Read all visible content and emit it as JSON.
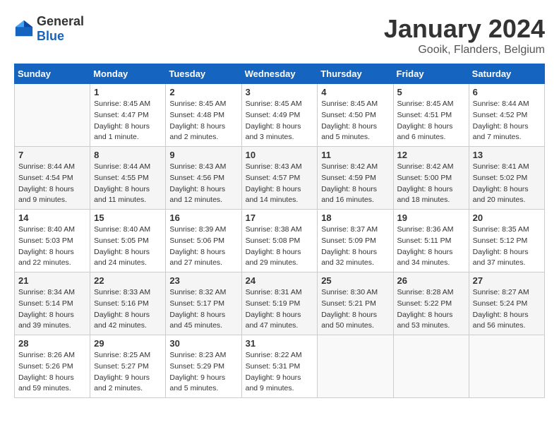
{
  "logo": {
    "text_general": "General",
    "text_blue": "Blue"
  },
  "title": "January 2024",
  "subtitle": "Gooik, Flanders, Belgium",
  "days_of_week": [
    "Sunday",
    "Monday",
    "Tuesday",
    "Wednesday",
    "Thursday",
    "Friday",
    "Saturday"
  ],
  "weeks": [
    [
      {
        "day": "",
        "info": ""
      },
      {
        "day": "1",
        "info": "Sunrise: 8:45 AM\nSunset: 4:47 PM\nDaylight: 8 hours\nand 1 minute."
      },
      {
        "day": "2",
        "info": "Sunrise: 8:45 AM\nSunset: 4:48 PM\nDaylight: 8 hours\nand 2 minutes."
      },
      {
        "day": "3",
        "info": "Sunrise: 8:45 AM\nSunset: 4:49 PM\nDaylight: 8 hours\nand 3 minutes."
      },
      {
        "day": "4",
        "info": "Sunrise: 8:45 AM\nSunset: 4:50 PM\nDaylight: 8 hours\nand 5 minutes."
      },
      {
        "day": "5",
        "info": "Sunrise: 8:45 AM\nSunset: 4:51 PM\nDaylight: 8 hours\nand 6 minutes."
      },
      {
        "day": "6",
        "info": "Sunrise: 8:44 AM\nSunset: 4:52 PM\nDaylight: 8 hours\nand 7 minutes."
      }
    ],
    [
      {
        "day": "7",
        "info": "Sunrise: 8:44 AM\nSunset: 4:54 PM\nDaylight: 8 hours\nand 9 minutes."
      },
      {
        "day": "8",
        "info": "Sunrise: 8:44 AM\nSunset: 4:55 PM\nDaylight: 8 hours\nand 11 minutes."
      },
      {
        "day": "9",
        "info": "Sunrise: 8:43 AM\nSunset: 4:56 PM\nDaylight: 8 hours\nand 12 minutes."
      },
      {
        "day": "10",
        "info": "Sunrise: 8:43 AM\nSunset: 4:57 PM\nDaylight: 8 hours\nand 14 minutes."
      },
      {
        "day": "11",
        "info": "Sunrise: 8:42 AM\nSunset: 4:59 PM\nDaylight: 8 hours\nand 16 minutes."
      },
      {
        "day": "12",
        "info": "Sunrise: 8:42 AM\nSunset: 5:00 PM\nDaylight: 8 hours\nand 18 minutes."
      },
      {
        "day": "13",
        "info": "Sunrise: 8:41 AM\nSunset: 5:02 PM\nDaylight: 8 hours\nand 20 minutes."
      }
    ],
    [
      {
        "day": "14",
        "info": "Sunrise: 8:40 AM\nSunset: 5:03 PM\nDaylight: 8 hours\nand 22 minutes."
      },
      {
        "day": "15",
        "info": "Sunrise: 8:40 AM\nSunset: 5:05 PM\nDaylight: 8 hours\nand 24 minutes."
      },
      {
        "day": "16",
        "info": "Sunrise: 8:39 AM\nSunset: 5:06 PM\nDaylight: 8 hours\nand 27 minutes."
      },
      {
        "day": "17",
        "info": "Sunrise: 8:38 AM\nSunset: 5:08 PM\nDaylight: 8 hours\nand 29 minutes."
      },
      {
        "day": "18",
        "info": "Sunrise: 8:37 AM\nSunset: 5:09 PM\nDaylight: 8 hours\nand 32 minutes."
      },
      {
        "day": "19",
        "info": "Sunrise: 8:36 AM\nSunset: 5:11 PM\nDaylight: 8 hours\nand 34 minutes."
      },
      {
        "day": "20",
        "info": "Sunrise: 8:35 AM\nSunset: 5:12 PM\nDaylight: 8 hours\nand 37 minutes."
      }
    ],
    [
      {
        "day": "21",
        "info": "Sunrise: 8:34 AM\nSunset: 5:14 PM\nDaylight: 8 hours\nand 39 minutes."
      },
      {
        "day": "22",
        "info": "Sunrise: 8:33 AM\nSunset: 5:16 PM\nDaylight: 8 hours\nand 42 minutes."
      },
      {
        "day": "23",
        "info": "Sunrise: 8:32 AM\nSunset: 5:17 PM\nDaylight: 8 hours\nand 45 minutes."
      },
      {
        "day": "24",
        "info": "Sunrise: 8:31 AM\nSunset: 5:19 PM\nDaylight: 8 hours\nand 47 minutes."
      },
      {
        "day": "25",
        "info": "Sunrise: 8:30 AM\nSunset: 5:21 PM\nDaylight: 8 hours\nand 50 minutes."
      },
      {
        "day": "26",
        "info": "Sunrise: 8:28 AM\nSunset: 5:22 PM\nDaylight: 8 hours\nand 53 minutes."
      },
      {
        "day": "27",
        "info": "Sunrise: 8:27 AM\nSunset: 5:24 PM\nDaylight: 8 hours\nand 56 minutes."
      }
    ],
    [
      {
        "day": "28",
        "info": "Sunrise: 8:26 AM\nSunset: 5:26 PM\nDaylight: 8 hours\nand 59 minutes."
      },
      {
        "day": "29",
        "info": "Sunrise: 8:25 AM\nSunset: 5:27 PM\nDaylight: 9 hours\nand 2 minutes."
      },
      {
        "day": "30",
        "info": "Sunrise: 8:23 AM\nSunset: 5:29 PM\nDaylight: 9 hours\nand 5 minutes."
      },
      {
        "day": "31",
        "info": "Sunrise: 8:22 AM\nSunset: 5:31 PM\nDaylight: 9 hours\nand 9 minutes."
      },
      {
        "day": "",
        "info": ""
      },
      {
        "day": "",
        "info": ""
      },
      {
        "day": "",
        "info": ""
      }
    ]
  ]
}
